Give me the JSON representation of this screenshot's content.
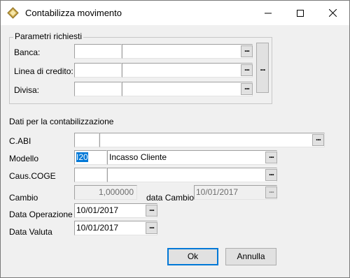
{
  "window": {
    "title": "Contabilizza movimento",
    "title_icon": "contabilizza-app-icon",
    "minimize_icon": "minimize-icon",
    "maximize_icon": "maximize-icon",
    "close_icon": "close-icon"
  },
  "parametri": {
    "legend": "Parametri richiesti",
    "banca": {
      "label": "Banca:",
      "code": "",
      "description": ""
    },
    "linea_credito": {
      "label": "Linea di credito:",
      "code": "",
      "description": ""
    },
    "divisa": {
      "label": "Divisa:",
      "code": "",
      "description": ""
    },
    "browse_label": "..."
  },
  "contabilizzazione": {
    "heading": "Dati per la contabilizzazione",
    "cabi": {
      "label": "C.ABI",
      "code": "",
      "description": ""
    },
    "modello": {
      "label": "Modello",
      "code": "I20",
      "description": "Incasso Cliente"
    },
    "caus_coge": {
      "label": "Caus.COGE",
      "code": "",
      "description": ""
    },
    "cambio": {
      "label": "Cambio",
      "value": "1,000000"
    },
    "data_cambio": {
      "label": "data Cambio",
      "value": "10/01/2017"
    },
    "data_operazione": {
      "label": "Data Operazione",
      "value": "10/01/2017"
    },
    "data_valuta": {
      "label": "Data Valuta",
      "value": "10/01/2017"
    },
    "browse_label": "..."
  },
  "buttons": {
    "ok": "Ok",
    "annulla": "Annulla"
  },
  "colors": {
    "selection": "#0078d7",
    "dialog_bg": "#f0f0f0"
  }
}
